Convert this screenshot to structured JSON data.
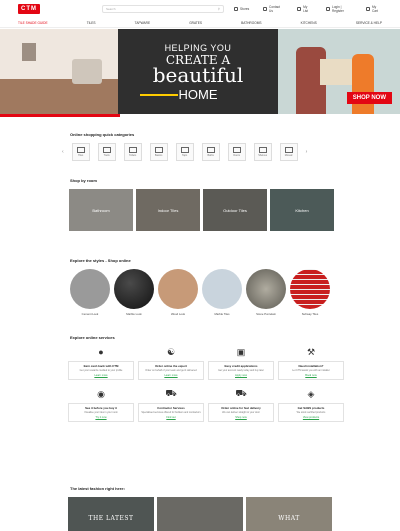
{
  "header": {
    "logo": "CTM",
    "search_placeholder": "Search",
    "links": [
      "Stores",
      "Contact Us",
      "My List",
      "Login | Register",
      "My Cart"
    ]
  },
  "nav": {
    "items": [
      "TILE SHADE GUIDE",
      "TILES",
      "TAPWARE",
      "GRATES",
      "BATHROOMS",
      "KITCHENS",
      "SERVICE & HELP"
    ]
  },
  "hero": {
    "line1": "HELPING YOU",
    "line2": "CREATE A",
    "line3": "beautiful",
    "line4": "HOME",
    "cta": "SHOP NOW",
    "accent": "#e30613"
  },
  "quick_categories": {
    "title": "Online shopping quick categories",
    "items": [
      "Tiles",
      "Tools",
      "Toilets",
      "Basins",
      "Taps",
      "Baths",
      "Doors",
      "Shelves",
      "Mosaic"
    ]
  },
  "rooms": {
    "title": "Shop by room",
    "items": [
      "Bathroom",
      "Indoor Tiles",
      "Outdoor Tiles",
      "Kitchen"
    ]
  },
  "styles": {
    "title": "Explore the styles - Shop online",
    "items": [
      {
        "label": "Cement Look",
        "color": "#9a9a9a"
      },
      {
        "label": "Marble Look",
        "color": "#1b1b1b"
      },
      {
        "label": "Wood Look",
        "color": "#c79a78"
      },
      {
        "label": "Marble Tiles",
        "color": "#c9d4dd"
      },
      {
        "label": "Stone Porcelain",
        "color": "#7d7a72"
      },
      {
        "label": "Subway Tiles",
        "color": "#c81e1e"
      }
    ]
  },
  "services": {
    "title": "Explore online services",
    "items": [
      {
        "title": "Earn cash back with CTM",
        "desc": "Get your rewards credited to your profile",
        "link": "Learn more"
      },
      {
        "title": "Order online the expert",
        "desc": "Order on behalf of your team and get it delivered",
        "link": "Learn more"
      },
      {
        "title": "Easy credit applications",
        "desc": "Get your account ready today and buy later",
        "link": "Apply now"
      },
      {
        "title": "Need installation?",
        "desc": "Let CTM assist you with an installer",
        "link": "Book now"
      },
      {
        "title": "See it before you buy it",
        "desc": "Visualise your tiles in your room",
        "link": "Try it now"
      },
      {
        "title": "Contractor Services",
        "desc": "Specialised services offered for builders and contractors",
        "link": "Find out"
      },
      {
        "title": "Order online for fast delivery",
        "desc": "We can deliver straight to your door",
        "link": "Shop now"
      },
      {
        "title": "Get SABS products",
        "desc": "We stock certified products",
        "link": "View products"
      }
    ]
  },
  "fashion": {
    "title": "The latest fashion right here:",
    "cards": [
      "THE LATEST",
      "",
      "WHAT"
    ]
  }
}
